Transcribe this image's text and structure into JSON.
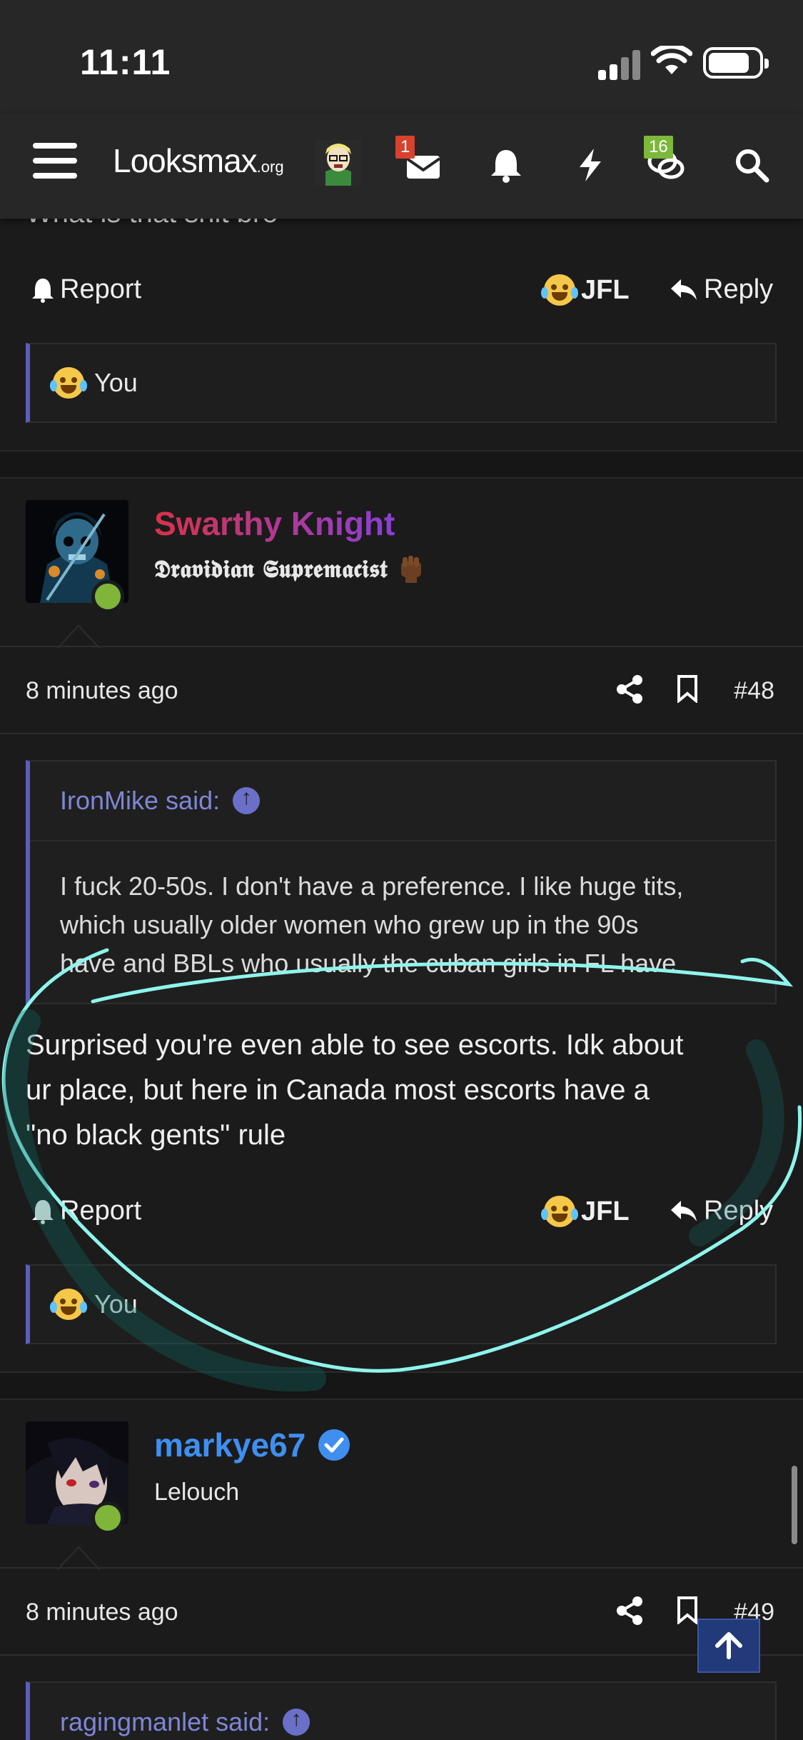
{
  "status_bar": {
    "time": "11:11"
  },
  "nav": {
    "logo_main": "Looksmax",
    "logo_suffix": ".org",
    "inbox_badge": "1",
    "chat_badge": "16"
  },
  "top_post": {
    "cut_text": "What is that shit bro",
    "report_label": "Report",
    "reaction_label": "JFL",
    "reply_label": "Reply",
    "reactions_summary": "You"
  },
  "post_48": {
    "username": "Swarthy Knight",
    "user_title": "𝕯𝖗𝖆𝖛𝖎𝖉𝖎𝖆𝖓 𝕾𝖚𝖕𝖗𝖊𝖒𝖆𝖈𝖎𝖘𝖙",
    "timestamp": "8 minutes ago",
    "post_number": "#48",
    "quote_author": "IronMike said:",
    "quote_lines": [
      "I fuck 20-50s. I don't have a preference. I like huge tits,",
      "which usually older women who grew up in the 90s",
      "have and BBLs who usually the cuban girls in FL have"
    ],
    "body_lines": [
      "Surprised you're even able to see escorts. Idk about",
      "ur place, but here in Canada most escorts have a",
      "\"no black gents\" rule"
    ],
    "report_label": "Report",
    "reaction_label": "JFL",
    "reply_label": "Reply",
    "reactions_summary": "You"
  },
  "post_49": {
    "username": "markye67",
    "user_title": "Lelouch",
    "timestamp": "8 minutes ago",
    "post_number": "#49",
    "quote_author": "ragingmanlet said:"
  },
  "colors": {
    "swarthy_gradient": [
      "#d8324a",
      "#8a3fd6"
    ],
    "markye_blue": "#3f8ff0",
    "quote_accent": "#5a5fbf",
    "annotation": "#8ef5ec"
  }
}
